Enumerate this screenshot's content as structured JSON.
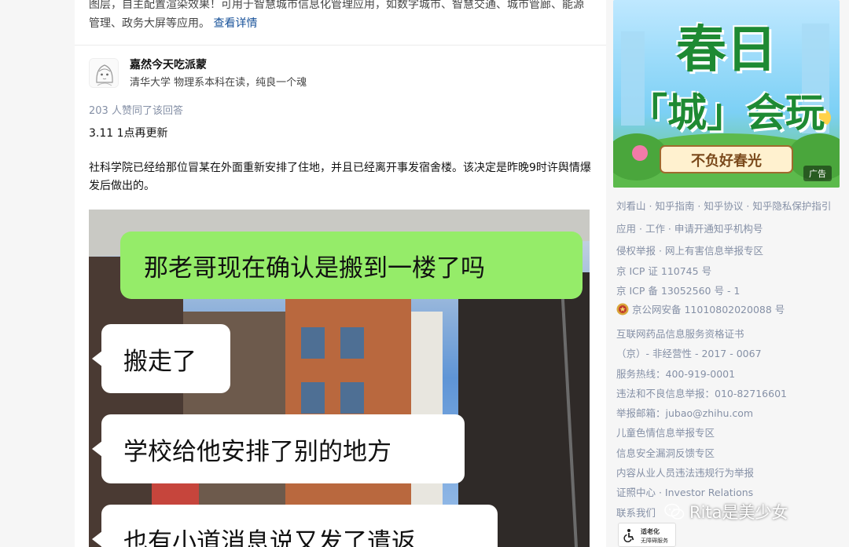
{
  "answer_intro": {
    "text": "图层，自主配置渲染效果！可用于智慧城市信息化管理应用，如数字城市、智慧交通、城市管廊、能源管理、政务大屏等应用。",
    "more_link": "查看详情"
  },
  "author": {
    "name": "嘉然今天吃派蒙",
    "bio": "清华大学 物理系本科在读，纯良一个魂",
    "avatar_icon": "anime-avatar-icon"
  },
  "answer": {
    "votes": "203 人赞同了该回答",
    "update": "3.11 1点再更新",
    "paragraph": "社科学院已经给那位冒某在外面重新安排了住地，并且已经离开事发宿舍楼。该决定是昨晚9时许舆情爆发后做出的。"
  },
  "chat_image": {
    "bubbles": [
      {
        "text": "那老哥现在确认是搬到一楼了吗",
        "side": "right",
        "color": "#95ec69"
      },
      {
        "text": "搬走了",
        "side": "left",
        "color": "#ffffff"
      },
      {
        "text": "学校给他安排了别的地方",
        "side": "left",
        "color": "#ffffff"
      },
      {
        "text": "也有小道消息说又发了遣返",
        "side": "left",
        "color": "#ffffff"
      }
    ]
  },
  "ad": {
    "line1": "春日",
    "line2": "「城」会玩",
    "banner": "不负好春光",
    "badge": "广告"
  },
  "footer": {
    "row1": [
      "刘看山",
      "知乎指南",
      "知乎协议",
      "知乎隐私保护指引"
    ],
    "row2": [
      "应用",
      "工作",
      "申请开通知乎机构号"
    ],
    "row3": [
      "侵权举报",
      "网上有害信息举报专区"
    ],
    "icp1": "京 ICP 证 110745 号",
    "icp2": "京 ICP 备 13052560 号 - 1",
    "police": "京公网安备 11010802020088 号",
    "drug1": "互联网药品信息服务资格证书",
    "drug2": "（京）- 非经营性 - 2017 - 0067",
    "hotline": "服务热线：400-919-0001",
    "report": "违法和不良信息举报：010-82716601",
    "email": "举报邮箱：jubao@zhihu.com",
    "child": "儿童色情信息举报专区",
    "security": "信息安全漏洞反馈专区",
    "staff": "内容从业人员违法违规行为举报",
    "investor": "证照中心 · Investor Relations",
    "contact": "联系我们"
  },
  "elder_badge": {
    "line1": "适老化",
    "line2": "无障碍服务"
  },
  "watermark": "Rita是美少女",
  "colors": {
    "link": "#175199",
    "muted": "#8590a6",
    "wechat_green": "#95ec69"
  }
}
